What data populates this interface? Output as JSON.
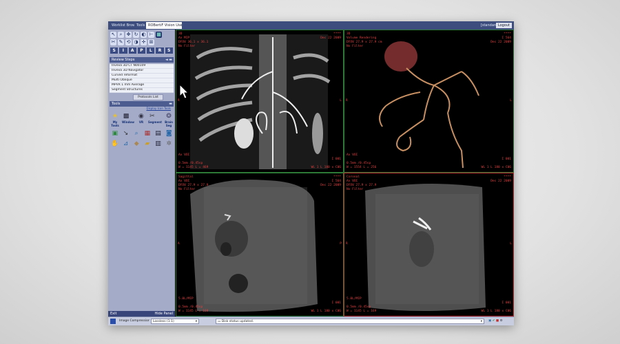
{
  "tabs": {
    "items": [
      {
        "label": "Worklist Browser"
      },
      {
        "label": "Tools"
      },
      {
        "label": "ROBertiF Vision User Entry L"
      }
    ]
  },
  "session": {
    "user": "[standard]",
    "logout": "Logout"
  },
  "toolbar": {
    "letters": [
      "S",
      "I",
      "A",
      "P",
      "L",
      "R",
      "S"
    ]
  },
  "review_steps": {
    "header": "Review Steps",
    "items": [
      "Inveva 3D CT N00109",
      "Inveva 3D Navigator",
      "Curved reformat",
      "Multi Oblique",
      "MPVR 1 mm Average",
      "Segment Structures"
    ],
    "protocols_label": "Protocols List"
  },
  "tools": {
    "header": "Tools",
    "display_link": "Display Icon Tools",
    "my_tools_label": "My Tools",
    "tool_labels": [
      "Window",
      "VR",
      "Segment",
      "Brain Seg"
    ]
  },
  "left_bottom": {
    "exit": "Exit",
    "hide": "Hide Panel"
  },
  "viewports": [
    {
      "tl": "3D\nAx MIP\nDFOV 36.1 x 36.1\nNo Filter",
      "tr": "****\nDec 22 2009",
      "bl": "Ax VOI\n\n0.5mm /0.45sp\nW = 1145 L = 469",
      "br": "I 001\n\nWL 1 L 180 x C06",
      "lm": "R",
      "rm": "L"
    },
    {
      "tl": "3D\nVolume Rendering\nDFOV 27.9 x 27.9 cm\nNo Filter",
      "tr": "****\nI 564\nDec 22 2009",
      "bl": "Ax VOI\n\n0.5mm /0.45sp\nW = 1554 L = 256",
      "br": "I 001\n\nWL 1 L 180 x C06",
      "lm": "R",
      "rm": "L"
    },
    {
      "tl": "Sagittal\nAx VOI\nDFOV 27.9 x 27.9\nNo Filter",
      "tr": "****\nI 564\nDec 22 2009",
      "bl": "5.0L/MIP\n\n0.5mm /0.45sp\nW = 1145 L = 169",
      "br": "I 001\n\nWL 1 L 180 x C06",
      "lm": "A",
      "rm": "P"
    },
    {
      "tl": "Coronal\nAx VOI\nDFOV 27.9 x 27.9\nNo Filter",
      "tr": "****\nDec 22 2009",
      "bl": "5.0L/MIP\n\n0.5mm /0.45sp\nW = 1145 L = 169",
      "br": "I 001\n\nWL 1 L 180 x C06",
      "lm": "R",
      "rm": "L"
    }
  ],
  "status_bar": {
    "image_compression": "Image Compression",
    "compression_value": "Lossless (1:1)",
    "disk_status": "Disk status updated."
  },
  "colors": {
    "accent": "#3d4e7e",
    "panel": "#a3abc9",
    "viewport_active": "#c03030",
    "viewport": "#2c7a36",
    "overlay": "#e04040"
  }
}
